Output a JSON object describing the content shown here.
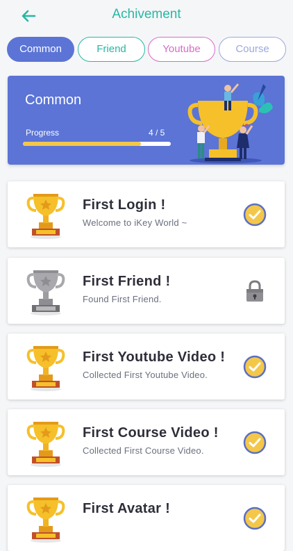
{
  "header": {
    "title": "Achivement"
  },
  "tabs": [
    {
      "label": "Common",
      "active": true,
      "color": "#5b74d6"
    },
    {
      "label": "Friend",
      "active": false,
      "color": "#27b7a3"
    },
    {
      "label": "Youtube",
      "active": false,
      "color": "#d86bc8"
    },
    {
      "label": "Course",
      "active": false,
      "color": "#9da7dd"
    }
  ],
  "banner": {
    "title": "Common",
    "progress_label": "Progress",
    "progress_text": "4 / 5",
    "progress_fraction": 0.8,
    "illustration": "trophy-with-people"
  },
  "achievements": [
    {
      "title": "First Login !",
      "description": "Welcome to iKey World ~",
      "trophy": "gold",
      "status": "check-icon"
    },
    {
      "title": "First Friend !",
      "description": "Found First Friend.",
      "trophy": "silver",
      "status": "lock-icon"
    },
    {
      "title": "First Youtube Video !",
      "description": "Collected First Youtube Video.",
      "trophy": "gold",
      "status": "check-icon"
    },
    {
      "title": "First Course Video !",
      "description": "Collected First Course Video.",
      "trophy": "gold",
      "status": "check-icon"
    },
    {
      "title": "First Avatar !",
      "description": "",
      "trophy": "gold",
      "status": "check-icon"
    }
  ],
  "colors": {
    "accent": "#27b7a3",
    "banner": "#5b74d6",
    "progress": "#f3c74a",
    "gold": "#f5c02a",
    "silver": "#a9a9ad"
  }
}
